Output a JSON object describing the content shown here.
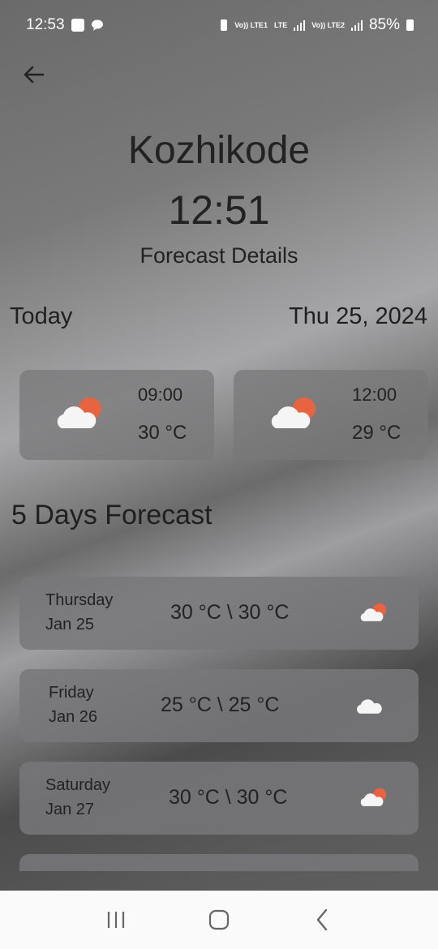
{
  "status_bar": {
    "time": "12:53",
    "network_1": "Vo)) LTE1",
    "network_lte": "LTE",
    "network_2": "Vo)) LTE2",
    "battery": "85%"
  },
  "header": {
    "city": "Kozhikode",
    "time": "12:51",
    "subtitle": "Forecast Details"
  },
  "today": {
    "label": "Today",
    "date": "Thu 25, 2024",
    "hours": [
      {
        "time": "09:00",
        "temp": "30 °C",
        "icon": "cloud-sun-icon"
      },
      {
        "time": "12:00",
        "temp": "29 °C",
        "icon": "cloud-sun-icon"
      }
    ]
  },
  "forecast": {
    "title": "5 Days Forecast",
    "days": [
      {
        "day": "Thursday",
        "date": "Jan 25",
        "range": "30 °C \\ 30 °C",
        "icon": "cloud-sun-icon"
      },
      {
        "day": "Friday",
        "date": "Jan 26",
        "range": "25 °C \\ 25 °C",
        "icon": "cloud-icon"
      },
      {
        "day": "Saturday",
        "date": "Jan 27",
        "range": "30 °C \\ 30 °C",
        "icon": "cloud-sun-icon"
      }
    ]
  },
  "colors": {
    "sun": "#e8633f",
    "cloud": "#f5f5f5"
  }
}
